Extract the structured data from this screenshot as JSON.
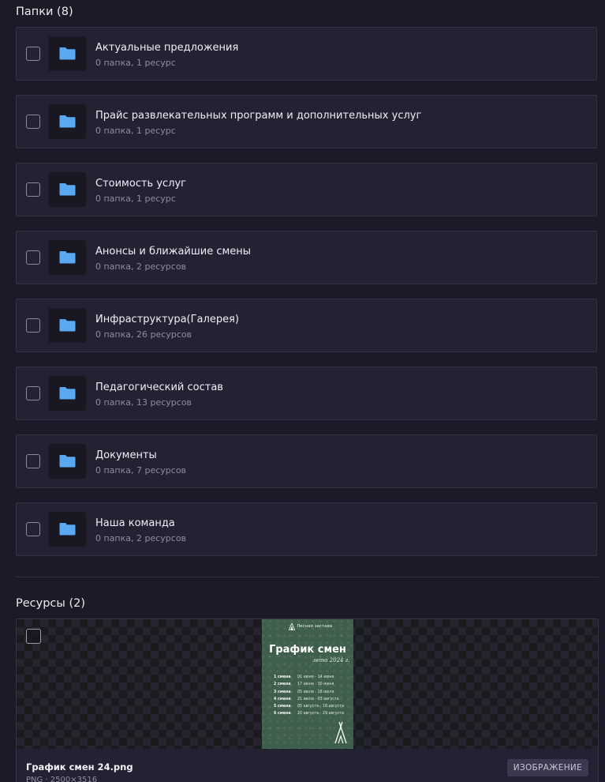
{
  "folders_section": {
    "title": "Папки (8)"
  },
  "folders": [
    {
      "name": "Актуальные предложения",
      "meta": "0 папка, 1 ресурс"
    },
    {
      "name": "Прайс развлекательных программ и дополнительных услуг",
      "meta": "0 папка, 1 ресурс"
    },
    {
      "name": "Стоимость услуг",
      "meta": "0 папка, 1 ресурс"
    },
    {
      "name": "Анонсы и ближайшие смены",
      "meta": "0 папка, 2 ресурсов"
    },
    {
      "name": "Инфраструктура(Галерея)",
      "meta": "0 папка, 26 ресурсов"
    },
    {
      "name": "Педагогический состав",
      "meta": "0 папка, 13 ресурсов"
    },
    {
      "name": "Документы",
      "meta": "0 папка, 7 ресурсов"
    },
    {
      "name": "Наша команда",
      "meta": "0 папка, 2 ресурсов"
    }
  ],
  "resources_section": {
    "title": "Ресурсы (2)"
  },
  "resource": {
    "file_name": "График смен 24.png",
    "meta": "PNG · 2500×3516",
    "badge": "ИЗОБРАЖЕНИЕ",
    "preview": {
      "logo_text": "Лесная застава",
      "title": "График смен",
      "subtitle": "лето 2024 г.",
      "rows": [
        {
          "shift": "1 смена",
          "dates": "01 июня - 14 июня"
        },
        {
          "shift": "2 смена",
          "dates": "17 июня - 30 июня"
        },
        {
          "shift": "3 смена",
          "dates": "05 июля - 18 июля"
        },
        {
          "shift": "4 смена",
          "dates": "21 июля - 03 августа"
        },
        {
          "shift": "5 смена",
          "dates": "05 августа - 18 августа"
        },
        {
          "shift": "6 смена",
          "dates": "20 августа - 29 августа"
        }
      ]
    }
  },
  "colors": {
    "background": "#1b1a27",
    "card": "#232233",
    "folder_icon": "#5aa8f0",
    "poster_green": "#3f5e4c"
  },
  "icons": {
    "folder": "folder-icon",
    "checkbox": "checkbox-icon"
  }
}
